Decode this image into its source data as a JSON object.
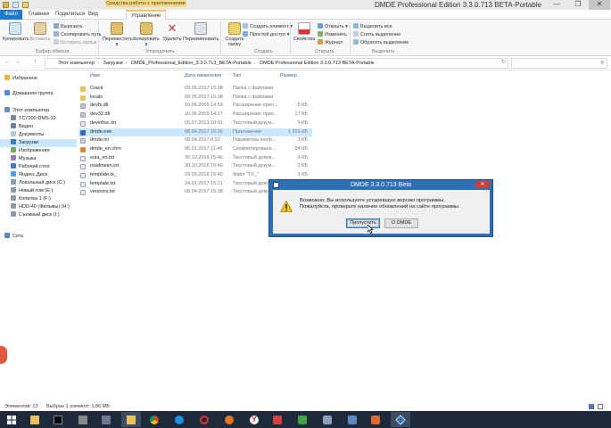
{
  "window": {
    "title": "DMDE Professional Edition 3.3.0.713 BETA-Portable",
    "context_tab_header": "Средства работы с приложениями",
    "minimize": "—",
    "maximize": "❐",
    "close": "✕"
  },
  "ribbon_tabs": {
    "file": "Файл",
    "home": "Главная",
    "share": "Поделиться",
    "view": "Вид",
    "manage": "Управление"
  },
  "ribbon": {
    "copy": "Копировать",
    "paste": "Вставить",
    "cut": "Вырезать",
    "copy_path": "Скопировать путь",
    "paste_shortcut": "Вставить ярлык",
    "clipboard_group": "Буфер обмена",
    "move_to": "Переместить в",
    "copy_to": "Копировать в",
    "delete": "Удалить",
    "rename": "Переименовать",
    "organize_group": "Упорядочить",
    "new_folder": "Создать папку",
    "new_item": "Создать элемент",
    "easy_access": "Простой доступ",
    "create_group": "Создать",
    "properties": "Свойства",
    "open": "Открыть",
    "edit": "Изменить",
    "history": "Журнал",
    "open_group": "Открыть",
    "select_all": "Выделить все",
    "select_none": "Снять выделение",
    "invert_selection": "Обратить выделение",
    "select_group": "Выделить"
  },
  "address": {
    "parts": [
      "Этот компьютер",
      "Загрузки",
      "DMDE_Professional_Edition_3.3.0.713_BETA-Portable",
      "DMDE Professional Edition 3.3.0.713 BETA-Portable"
    ],
    "back": "←",
    "forward": "→",
    "up": "↑",
    "refresh": "↻"
  },
  "nav": {
    "favorites": "Избранное",
    "homegroup": "Домашняя группа",
    "this_pc": "Этот компьютер",
    "items": [
      "TC7200-DMS-10",
      "Видео",
      "Документы",
      "Загрузки",
      "Изображения",
      "Музыка",
      "Рабочий стол",
      "Яндекс.Диск",
      "Локальный диск (C:)",
      "Новый том (E:)",
      "Копилка 1 (F:)",
      "HDD-40 (Фильмы) (H:)",
      "Съемный диск (I:)"
    ],
    "network": "Сеть"
  },
  "columns": {
    "name": "Имя",
    "date": "Дата изменения",
    "type": "Тип",
    "size": "Размер"
  },
  "files": [
    {
      "name": "Crack",
      "date": "09.05.2017 15:38",
      "type": "Папка с файлами",
      "size": "",
      "kind": "folder"
    },
    {
      "name": "locals",
      "date": "09.05.2017 15:38",
      "type": "Папка с файлами",
      "size": "",
      "kind": "folder"
    },
    {
      "name": "devfs.dll",
      "date": "16.06.2009 14:53",
      "type": "Расширение прил...",
      "size": "5 КБ",
      "kind": "dll"
    },
    {
      "name": "dev32.dll",
      "date": "16.06.2009 14:27",
      "type": "Расширение прил...",
      "size": "17 КБ",
      "kind": "dll"
    },
    {
      "name": "devioh‌sc.txt",
      "date": "05.07.2013 10:01",
      "type": "Текстовый докум...",
      "size": "5 КБ",
      "kind": "txt"
    },
    {
      "name": "dmde.exe",
      "date": "08.04.2017 15:36",
      "type": "Приложение",
      "size": "1 915 КБ",
      "kind": "exe",
      "selected": true
    },
    {
      "name": "dmde.ini",
      "date": "08.04.2017 8:52",
      "type": "Параметры конф...",
      "size": "1 КБ",
      "kind": "ini"
    },
    {
      "name": "dmde_en.chm",
      "date": "06.01.2017 11:46",
      "type": "Скомпилированн...",
      "size": "54 КБ",
      "kind": "chm"
    },
    {
      "name": "eula_en.txt",
      "date": "30.10.2016 15:40",
      "type": "Текстовый докум...",
      "size": "6 КБ",
      "kind": "txt"
    },
    {
      "name": "readmeen.txt",
      "date": "30.10.2016 15:40",
      "type": "Текстовый докум...",
      "size": "2 КБ",
      "kind": "txt"
    },
    {
      "name": "template.tx_",
      "date": "29.09.2016 15:40",
      "type": "Файл \"TX_\"",
      "size": "1 КБ",
      "kind": "txt"
    },
    {
      "name": "template.txt",
      "date": "24.01.2017 15:21",
      "type": "Текстовый докум...",
      "size": "1 КБ",
      "kind": "txt"
    },
    {
      "name": "versions.txt",
      "date": "08.04.2017 15:38",
      "type": "Текстовый докум...",
      "size": "27 КБ",
      "kind": "txt"
    }
  ],
  "status": {
    "items_count": "Элементов: 13",
    "selected": "Выбран 1 элемент: 1,86 МБ"
  },
  "dialog": {
    "title": "DMDE 3.3.0.713 Beta",
    "line1": "Возможно, Вы используете устаревшую версию программы.",
    "line2": "Пожалуйста, проверьте наличие обновлений на сайте программы.",
    "skip_button": "Пропустить",
    "about_button": "О DMDE",
    "close": "✕"
  },
  "taskbar": {
    "apps": [
      "start",
      "file-explorer",
      "terminal",
      "photo-viewer",
      "folder",
      "chrome",
      "edge",
      "opera",
      "firefox",
      "yandex-browser",
      "vivaldi",
      "camtasia",
      "tool",
      "paint",
      "calculator",
      "dmde"
    ]
  },
  "colors": {
    "accent": "#1979ca",
    "selection": "#cce8ff",
    "dialog_frame": "#2e6fb8",
    "taskbar": "#1c2a3c"
  }
}
